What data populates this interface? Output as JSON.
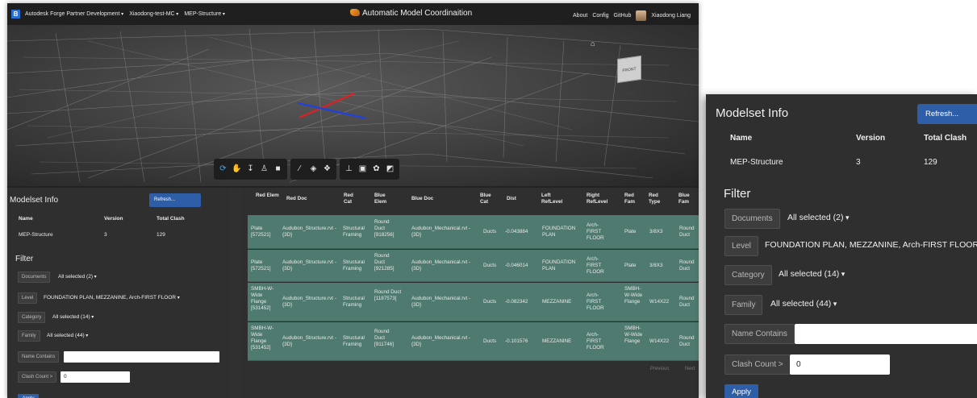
{
  "navbar": {
    "brand": "B",
    "hub": "Autodesk Forge Partner Development",
    "project": "Xiaodong-test-MC",
    "container": "MEP-Structure",
    "title": "Automatic Model Coordinaition",
    "links": [
      "About",
      "Config",
      "GitHub"
    ],
    "user": "Xiaodong Liang"
  },
  "viewer": {
    "viewcube_label": "FRONT RIGHT"
  },
  "modelset": {
    "title": "Modelset Info",
    "refresh_label": "Refresh...",
    "headers": {
      "name": "Name",
      "version": "Version",
      "total": "Total Clash"
    },
    "row": {
      "name": "MEP-Structure",
      "version": "3",
      "total": "129"
    }
  },
  "filter": {
    "title": "Filter",
    "documents_label": "Documents",
    "documents_value": "All selected (2)",
    "level_label": "Level",
    "level_value": "FOUNDATION PLAN, MEZZANINE, Arch-FIRST FLOOR",
    "category_label": "Category",
    "category_value": "All selected (14)",
    "family_label": "Family",
    "family_value": "All selected (44)",
    "name_contains_label": "Name Contains",
    "name_contains_value": "",
    "clash_count_label": "Clash Count >",
    "clash_count_value": "0",
    "apply_label": "Apply"
  },
  "clash_table": {
    "headers": {
      "red_elem": "Red Elem",
      "red_doc": "Red Doc",
      "red_cat": "Red Cat",
      "blue_elem": "Blue Elem",
      "blue_doc": "Blue Doc",
      "blue_cat": "Blue Cat",
      "dist": "Dist",
      "left_ref": "Left RefLevel",
      "right_ref": "Right RefLevel",
      "red_fam": "Red Fam",
      "red_type": "Red Type",
      "blue_fam": "Blue Fam"
    },
    "rows": [
      {
        "red_elem": "Plate [572521]",
        "red_doc": "Audubon_Structure.rvt - {3D}",
        "red_cat": "Structural Framing",
        "blue_elem": "Round Duct [918256]",
        "blue_doc": "Audubon_Mechanical.rvt - {3D}",
        "blue_cat": "Ducts",
        "dist": "-0.043884",
        "left_ref": "FOUNDATION PLAN",
        "right_ref": "Arch-FIRST FLOOR",
        "red_fam": "Plate",
        "red_type": "3/8X3",
        "blue_fam": "Round Duct"
      },
      {
        "red_elem": "Plate [572521]",
        "red_doc": "Audubon_Structure.rvt - {3D}",
        "red_cat": "Structural Framing",
        "blue_elem": "Round Duct [921285]",
        "blue_doc": "Audubon_Mechanical.rvt - {3D}",
        "blue_cat": "Ducts",
        "dist": "-0.046014",
        "left_ref": "FOUNDATION PLAN",
        "right_ref": "Arch-FIRST FLOOR",
        "red_fam": "Plate",
        "red_type": "3/8X3",
        "blue_fam": "Round Duct"
      },
      {
        "red_elem": "SMBH-W-Wide Flange [531452]",
        "red_doc": "Audubon_Structure.rvt - {3D}",
        "red_cat": "Structural Framing",
        "blue_elem": "Round Duct [1187573]",
        "blue_doc": "Audubon_Mechanical.rvt - {3D}",
        "blue_cat": "Ducts",
        "dist": "-0.082342",
        "left_ref": "MEZZANINE",
        "right_ref": "Arch-FIRST FLOOR",
        "red_fam": "SMBH-W-Wide Flange",
        "red_type": "W14X22",
        "blue_fam": "Round Duct"
      },
      {
        "red_elem": "SMBH-W-Wide Flange [531452]",
        "red_doc": "Audubon_Structure.rvt - {3D}",
        "red_cat": "Structural Framing",
        "blue_elem": "Round Duct [911746]",
        "blue_doc": "Audubon_Mechanical.rvt - {3D}",
        "blue_cat": "Ducts",
        "dist": "-0.101576",
        "left_ref": "MEZZANINE",
        "right_ref": "Arch-FIRST FLOOR",
        "red_fam": "SMBH-W-Wide Flange",
        "red_type": "W14X22",
        "blue_fam": "Round Duct"
      }
    ],
    "pager": {
      "previous": "Previous",
      "next": "Next"
    }
  },
  "colors": {
    "accent": "#2f5ea8",
    "row_bg": "#4e7a6f",
    "panel_bg": "#2f2f2f"
  },
  "icons": [
    "orbit-icon",
    "pan-icon",
    "zoom-icon",
    "walk-icon",
    "camera-icon",
    "measure-icon",
    "section-icon",
    "explode-icon",
    "model-browser-icon",
    "properties-icon",
    "settings-icon",
    "fullscreen-icon",
    "home-icon"
  ]
}
